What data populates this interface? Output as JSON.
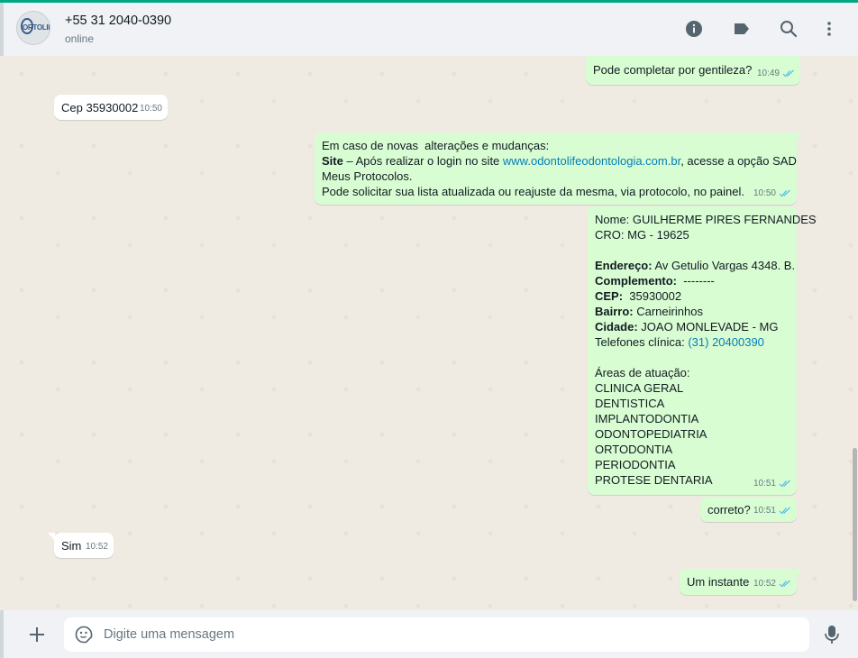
{
  "header": {
    "avatar_text": "ORTOLIFE",
    "contact_name": "+55 31 2040-0390",
    "status": "online",
    "icons": [
      "info-icon",
      "label-icon",
      "search-icon",
      "menu-icon"
    ]
  },
  "messages": [
    {
      "dir": "out",
      "lines": [
        "Pode completar por gentileza?"
      ],
      "time": "10:49",
      "read": true
    },
    {
      "dir": "in",
      "lines": [
        "Cep 35930002"
      ],
      "time": "10:50"
    },
    {
      "dir": "out",
      "lines": [
        "Em caso de novas  alterações e mudanças:",
        {
          "bold": "Site",
          "text": " – Após realizar o login no site ",
          "link": "www.odontolifeodontologia.com.br",
          "after": ", acesse a opção SAD"
        },
        "Meus Protocolos.",
        "Pode solicitar sua lista atualizada ou reajuste da mesma, via protocolo, no painel."
      ],
      "time": "10:50",
      "read": true
    },
    {
      "dir": "out",
      "lines": [
        "Nome: GUILHERME PIRES FERNANDES",
        "CRO: MG - 19625",
        "",
        {
          "bold": "Endereço:",
          "text": " Av Getulio Vargas 4348. B."
        },
        {
          "bold": "Complemento:",
          "text": "  --------"
        },
        {
          "bold": "CEP:",
          "text": "  35930002"
        },
        {
          "bold": "Bairro:",
          "text": " Carneirinhos"
        },
        {
          "bold": "Cidade:",
          "text": " JOAO MONLEVADE - MG"
        },
        {
          "text": "Telefones clínica: ",
          "link": "(31) 20400390"
        },
        "",
        "Áreas de atuação:",
        "CLINICA GERAL",
        "DENTISTICA",
        "IMPLANTODONTIA",
        "ODONTOPEDIATRIA",
        "ORTODONTIA",
        "PERIODONTIA",
        "PROTESE DENTARIA"
      ],
      "time": "10:51",
      "read": true
    },
    {
      "dir": "out",
      "lines": [
        "correto?"
      ],
      "time": "10:51",
      "read": true
    },
    {
      "dir": "in",
      "lines": [
        "Sim"
      ],
      "time": "10:52"
    },
    {
      "dir": "out",
      "lines": [
        "Um instante"
      ],
      "time": "10:52",
      "read": true
    }
  ],
  "composer": {
    "placeholder": "Digite uma mensagem",
    "icons": [
      "plus-icon",
      "sticker-icon",
      "mic-icon"
    ]
  },
  "colors": {
    "accent": "#00a884",
    "outgoing": "#d9fdd3",
    "incoming": "#ffffff",
    "chat_bg": "#efeae2",
    "link": "#027eb5",
    "read_ticks": "#53bdeb"
  }
}
